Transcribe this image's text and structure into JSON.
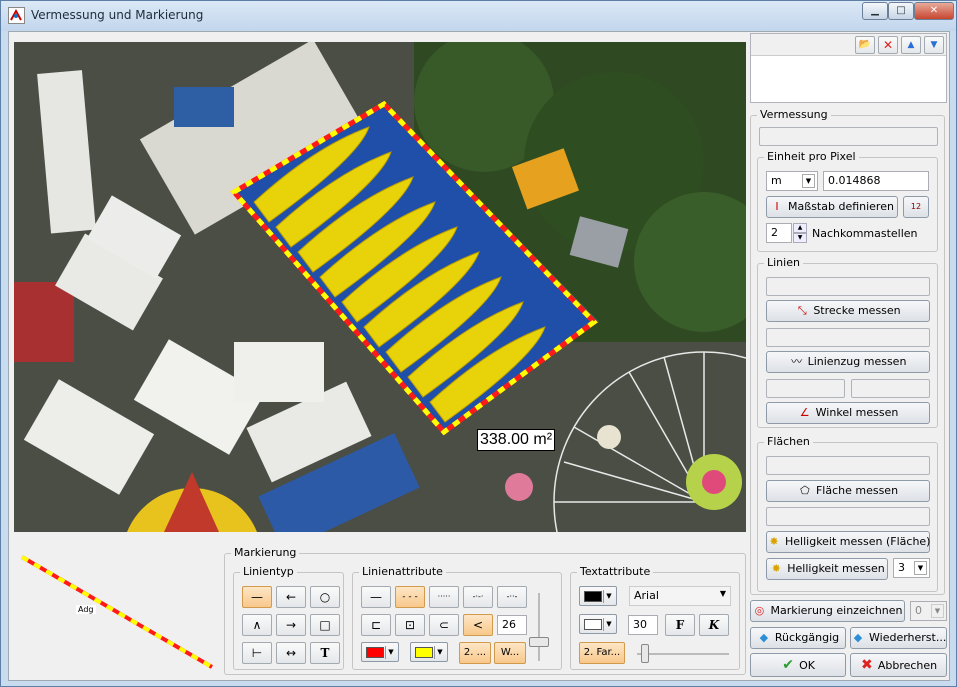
{
  "window": {
    "title": "Vermessung und Markierung",
    "minimize": "▁",
    "maximize": "□",
    "close": "✕"
  },
  "image": {
    "area_label": "338.00 m²"
  },
  "preview": {
    "label": "Adg"
  },
  "list_toolbar": {
    "open": "📂",
    "delete": "✕",
    "up": "▲",
    "down": "▼"
  },
  "vermessung": {
    "title": "Vermessung",
    "einheit": {
      "title": "Einheit pro Pixel",
      "unit": "m",
      "value": "0.014868",
      "define_button": "Maßstab definieren",
      "decimals": "2",
      "decimals_label": "Nachkommastellen",
      "icon_ruler": "12"
    },
    "linien": {
      "title": "Linien",
      "strecke": "Strecke messen",
      "linienzug": "Linienzug messen",
      "winkel": "Winkel messen"
    },
    "flaechen": {
      "title": "Flächen",
      "flaeche": "Fläche messen",
      "hell_flaeche": "Helligkeit messen (Fläche)",
      "hell": "Helligkeit messen",
      "hell_value": "3"
    }
  },
  "markierung": {
    "title": "Markierung",
    "linientyp": {
      "title": "Linientyp"
    },
    "linienattribute": {
      "title": "Linienattribute",
      "width": "26",
      "two_color": "2. ...",
      "w_button": "W...",
      "color1": "#ff0000",
      "color2": "#ffff00"
    },
    "textattribute": {
      "title": "Textattribute",
      "font": "Arial",
      "size": "30",
      "bold": "F",
      "italic": "K",
      "two_color": "2. Far...",
      "color_text": "#000000",
      "color_bg": "#ffffff"
    }
  },
  "actions": {
    "mark": "Markierung einzeichnen",
    "mark_count": "0",
    "undo": "Rückgängig",
    "redo": "Wiederherst...",
    "ok": "OK",
    "cancel": "Abbrechen"
  }
}
